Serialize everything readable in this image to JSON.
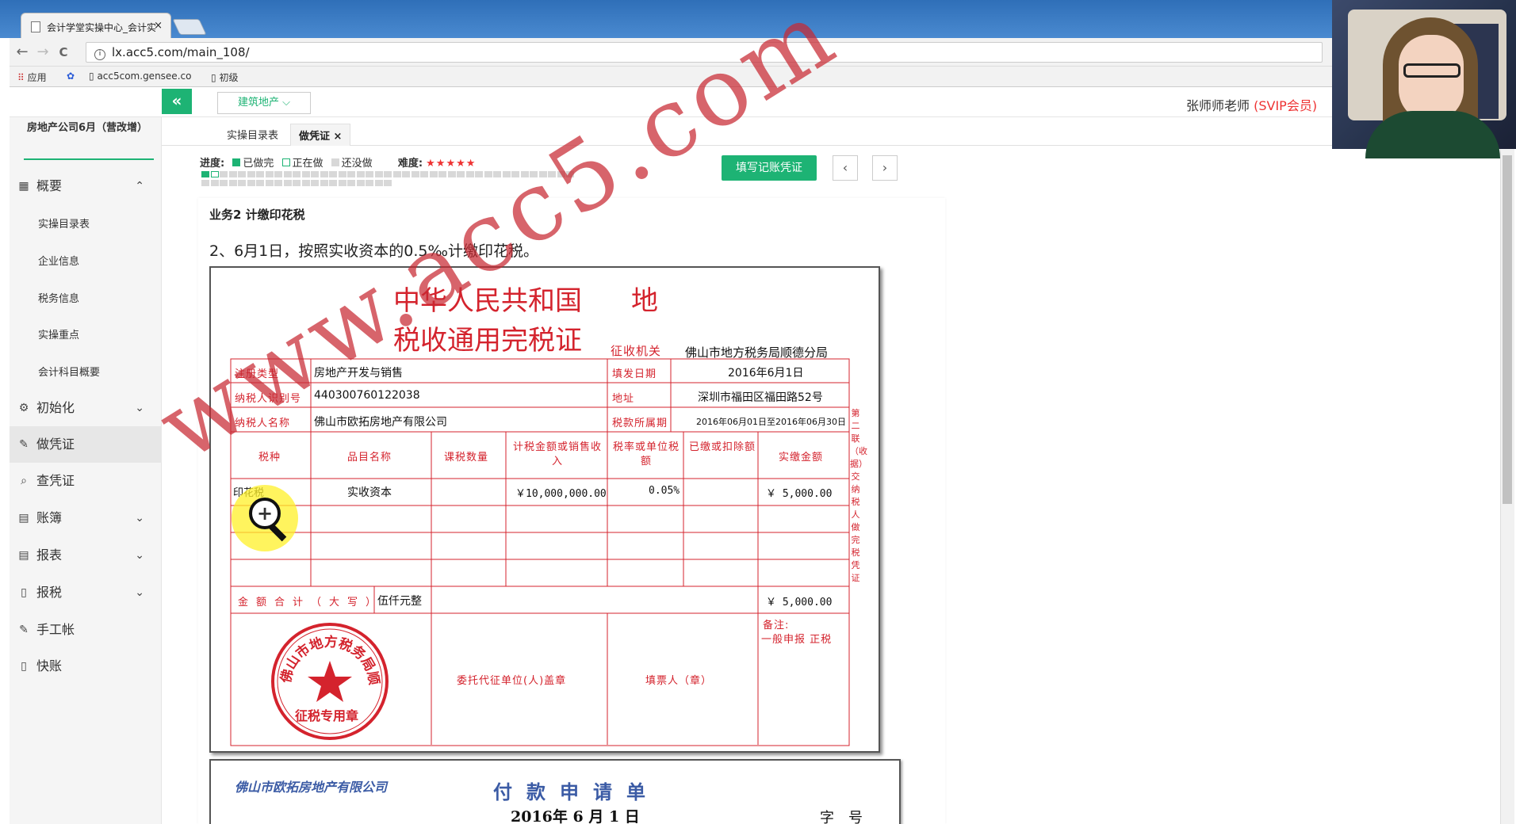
{
  "browser": {
    "tab_title": "会计学堂实操中心_会计实",
    "tab_close": "×",
    "url": "lx.acc5.com/main_108/",
    "nav_back": "←",
    "nav_forward": "→",
    "nav_reload": "C",
    "bookmarks": [
      "应用",
      "acc5com.gensee.co",
      "初级"
    ]
  },
  "header": {
    "collapse_icon": "«",
    "dropdown_label": "建筑地产 ⌵",
    "user_name": "张师师老师",
    "user_badge": "(SVIP会员)"
  },
  "sidebar": {
    "company": "房地产公司6月（营改增）",
    "items": [
      {
        "label": "概要",
        "icon": "▦",
        "chevron": "⌃"
      },
      {
        "label": "初始化",
        "icon": "⚙",
        "chevron": "⌄"
      },
      {
        "label": "做凭证",
        "icon": "✎",
        "chevron": ""
      },
      {
        "label": "查凭证",
        "icon": "⌕",
        "chevron": ""
      },
      {
        "label": "账簿",
        "icon": "▤",
        "chevron": "⌄"
      },
      {
        "label": "报表",
        "icon": "▤",
        "chevron": "⌄"
      },
      {
        "label": "报税",
        "icon": "▯",
        "chevron": "⌄"
      },
      {
        "label": "手工帐",
        "icon": "✎",
        "chevron": ""
      },
      {
        "label": "快账",
        "icon": "▯",
        "chevron": ""
      }
    ],
    "subitems": [
      "实操目录表",
      "企业信息",
      "税务信息",
      "实操重点",
      "会计科目概要"
    ]
  },
  "pagetabs": {
    "tab1": "实操目录表",
    "tab2": "做凭证",
    "tab2_close": "×"
  },
  "progress": {
    "label": "进度:",
    "done": "已做完",
    "doing": "正在做",
    "todo": "还没做",
    "difficulty_label": "难度:",
    "stars": "★★★★★",
    "cells_total": 62,
    "current_index": 1,
    "colors": {
      "done": "#1db374",
      "doing": "#1db374",
      "todo": "#d8d8d8"
    },
    "fill_button": "填写记账凭证",
    "prev": "‹",
    "next": "›"
  },
  "business": {
    "title": "业务2 计缴印花税",
    "description": "2、6月1日，按照实收资本的0.5‰计缴印花税。"
  },
  "certificate": {
    "title_line1": "中华人民共和国",
    "title_di": "地",
    "title_line2": "税收通用完税证",
    "authority_label": "征收机关",
    "authority": "佛山市地方税务局顺德分局",
    "reg_type_label": "注册类型",
    "reg_type": "房地产开发与销售",
    "issue_date_label": "填发日期",
    "issue_date": "2016年6月1日",
    "taxpayer_id_label": "纳税人识别号",
    "taxpayer_id": "440300760122038",
    "address_label": "地址",
    "address": "深圳市福田区福田路52号",
    "taxpayer_name_label": "纳税人名称",
    "taxpayer_name": "佛山市欧拓房地产有限公司",
    "period_label": "税款所属期",
    "period": "2016年06月01日至2016年06月30日",
    "columns": [
      "税种",
      "品目名称",
      "课税数量",
      "计税金额或销售收入",
      "税率或单位税额",
      "已缴或扣除额",
      "实缴金额"
    ],
    "row": {
      "tax_type": "印花税",
      "item": "实收资本",
      "quantity": "",
      "base": "￥10,000,000.00",
      "rate": "0.05%",
      "deducted": "",
      "amount": "￥  5,000.00"
    },
    "total_label": "金额合计（大写）",
    "total_words": "伍仟元整",
    "total_amount": "￥  5,000.00",
    "remark_label": "备注:",
    "remark": "一般申报 正税",
    "stamp_text": "佛山市地方税务局顺德分局",
    "stamp_bottom": "征税专用章",
    "agent_label": "委托代征单位(人)盖章",
    "filler_label": "填票人（章）",
    "side_note": "第二联（收据）交纳税人做完税凭证"
  },
  "watermark": "www.acc5.com",
  "payment": {
    "company": "佛山市欧拓房地产有限公司",
    "title": "付款申请单",
    "date": "2016年 6 月 1 日",
    "no_label": "字号"
  }
}
